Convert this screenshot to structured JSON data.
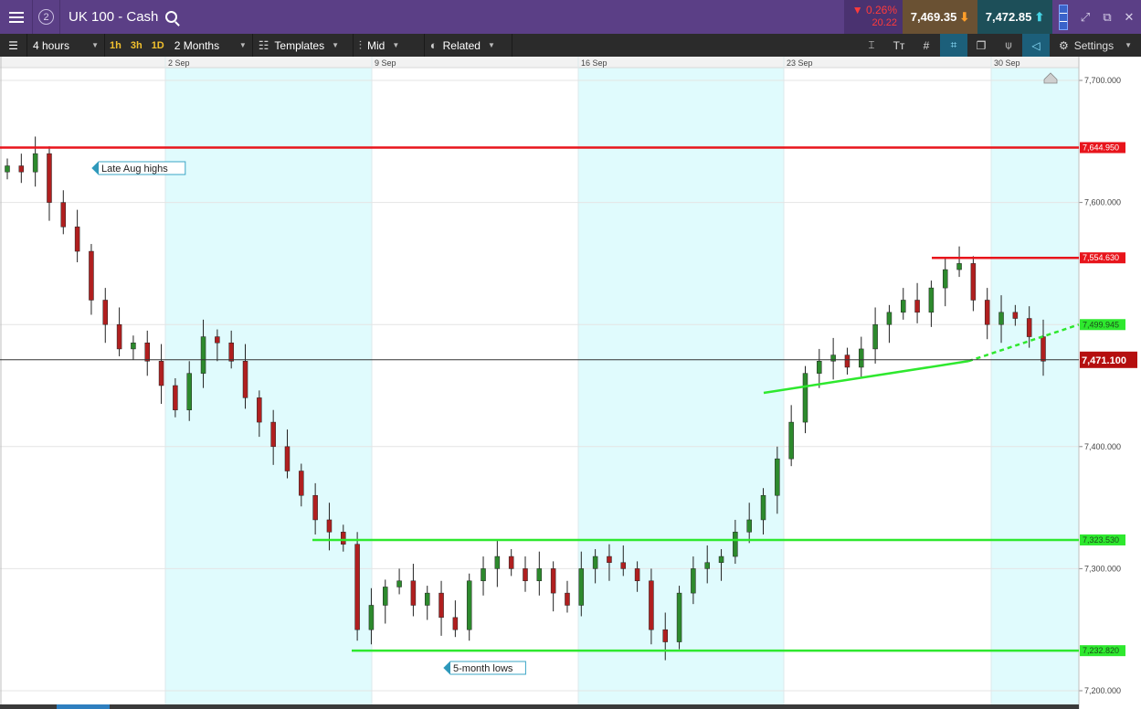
{
  "header": {
    "menu_icon": "hamburger-icon",
    "link_badge": "2",
    "title": "UK 100 - Cash",
    "change_pct": "▼ 0.26%",
    "change_abs": "20.22",
    "bid": "7,469.35",
    "ask": "7,472.85"
  },
  "toolbar": {
    "timeframe": "4 hours",
    "quick_frames": [
      "1h",
      "3h",
      "1D"
    ],
    "range": "2 Months",
    "templates": "Templates",
    "price_type": "Mid",
    "related": "Related",
    "settings": "Settings"
  },
  "colors": {
    "resistance": "#e8141b",
    "support": "#2ee82e",
    "bull_candle": "#2d8a2d",
    "bear_candle": "#b01f1f",
    "weekend_band": "#e0fbfd"
  },
  "chart_data": {
    "type": "candlestick",
    "instrument": "UK 100 - Cash",
    "interval": "4 hours",
    "x_tick_labels": [
      "2 Sep",
      "9 Sep",
      "16 Sep",
      "23 Sep",
      "30 Sep"
    ],
    "y_tick_labels": [
      "7,700.000",
      "7,600.000",
      "7,400.000",
      "7,300.000",
      "7,200.000"
    ],
    "ylim": [
      7195,
      7705
    ],
    "horizontal_levels": [
      {
        "price": 7644.95,
        "label": "7,644.950",
        "kind": "resistance"
      },
      {
        "price": 7554.63,
        "label": "7,554.630",
        "kind": "resistance"
      },
      {
        "price": 7323.53,
        "label": "7,323.530",
        "kind": "support"
      },
      {
        "price": 7232.82,
        "label": "7,232.820",
        "kind": "support"
      }
    ],
    "trendline_label": "7,499.945",
    "current_price_label": "7,471.100",
    "current_price": 7471.1,
    "annotations": [
      "Late Aug highs",
      "5-month lows"
    ],
    "candles_approx_close": [
      7630,
      7625,
      7640,
      7600,
      7580,
      7560,
      7520,
      7500,
      7480,
      7485,
      7470,
      7450,
      7430,
      7460,
      7490,
      7485,
      7470,
      7440,
      7420,
      7400,
      7380,
      7360,
      7340,
      7330,
      7320,
      7250,
      7270,
      7285,
      7290,
      7270,
      7280,
      7260,
      7250,
      7290,
      7300,
      7310,
      7300,
      7290,
      7300,
      7280,
      7270,
      7300,
      7310,
      7305,
      7300,
      7290,
      7250,
      7240,
      7280,
      7300,
      7305,
      7310,
      7330,
      7340,
      7360,
      7390,
      7420,
      7460,
      7470,
      7475,
      7465,
      7480,
      7500,
      7510,
      7520,
      7510,
      7530,
      7545,
      7550,
      7520,
      7500,
      7510,
      7505,
      7490,
      7470
    ]
  }
}
